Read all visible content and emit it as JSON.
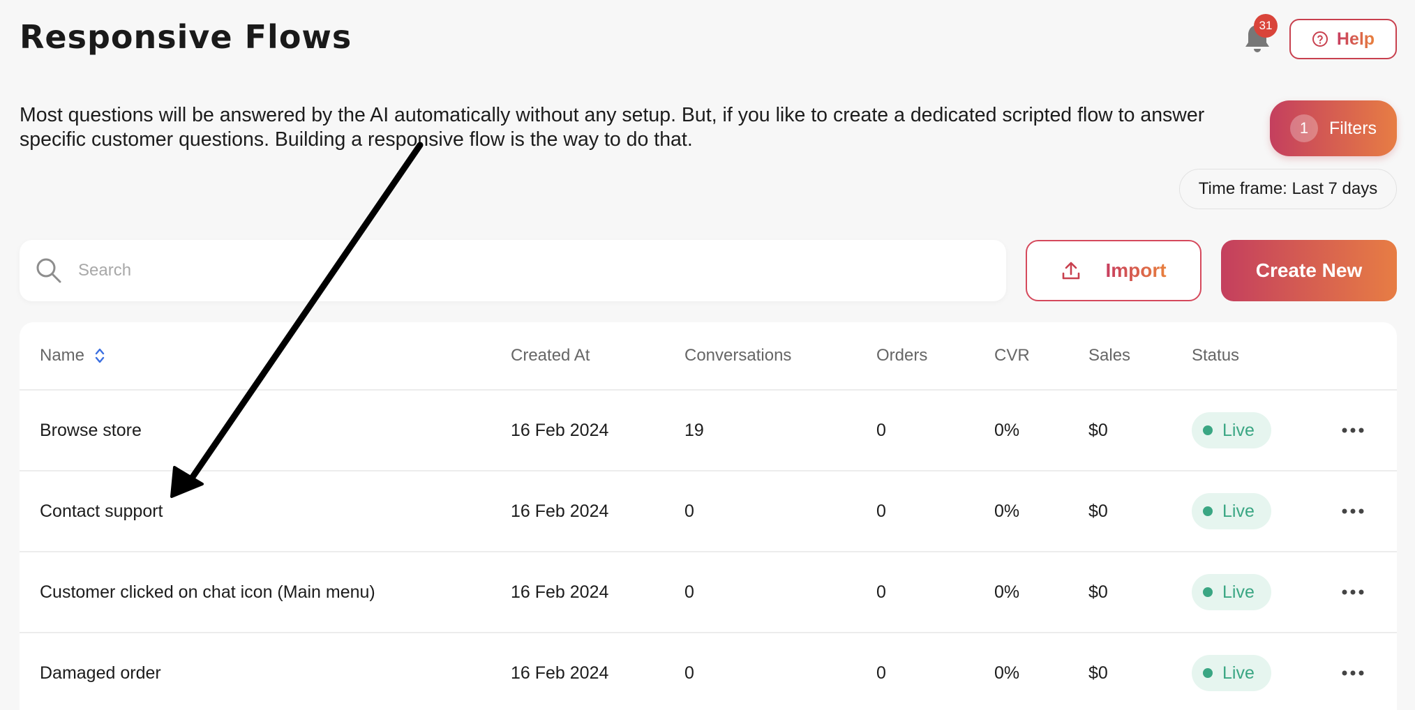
{
  "page": {
    "title": "Responsive Flows",
    "notification_count": "31",
    "help_label": "Help",
    "intro": "Most questions will be answered by the AI automatically without any setup. But, if you like to create a dedicated scripted flow to answer specific customer questions. Building a responsive flow is the way to do that."
  },
  "filters": {
    "count": "1",
    "label": "Filters",
    "timeframe": "Time frame: Last 7 days"
  },
  "toolbar": {
    "search_placeholder": "Search",
    "search_value": "",
    "import_label": "Import",
    "create_label": "Create New"
  },
  "table": {
    "headers": [
      "Name",
      "Created At",
      "Conversations",
      "Orders",
      "CVR",
      "Sales",
      "Status"
    ],
    "rows": [
      {
        "name": "Browse store",
        "created": "16 Feb 2024",
        "conversations": "19",
        "orders": "0",
        "cvr": "0%",
        "sales": "$0",
        "status": "Live"
      },
      {
        "name": "Contact support",
        "created": "16 Feb 2024",
        "conversations": "0",
        "orders": "0",
        "cvr": "0%",
        "sales": "$0",
        "status": "Live"
      },
      {
        "name": "Customer clicked on chat icon (Main menu)",
        "created": "16 Feb 2024",
        "conversations": "0",
        "orders": "0",
        "cvr": "0%",
        "sales": "$0",
        "status": "Live"
      },
      {
        "name": "Damaged order",
        "created": "16 Feb 2024",
        "conversations": "0",
        "orders": "0",
        "cvr": "0%",
        "sales": "$0",
        "status": "Live"
      }
    ]
  },
  "colors": {
    "accent_start": "#c43f5e",
    "accent_end": "#e77d44",
    "live_green": "#3aa683",
    "badge_red": "#d9443a"
  },
  "icons": [
    "bell-icon",
    "help-circle-icon",
    "search-icon",
    "upload-icon",
    "sort-icon",
    "status-dot-icon",
    "more-horizontal-icon",
    "annotation-arrow"
  ]
}
